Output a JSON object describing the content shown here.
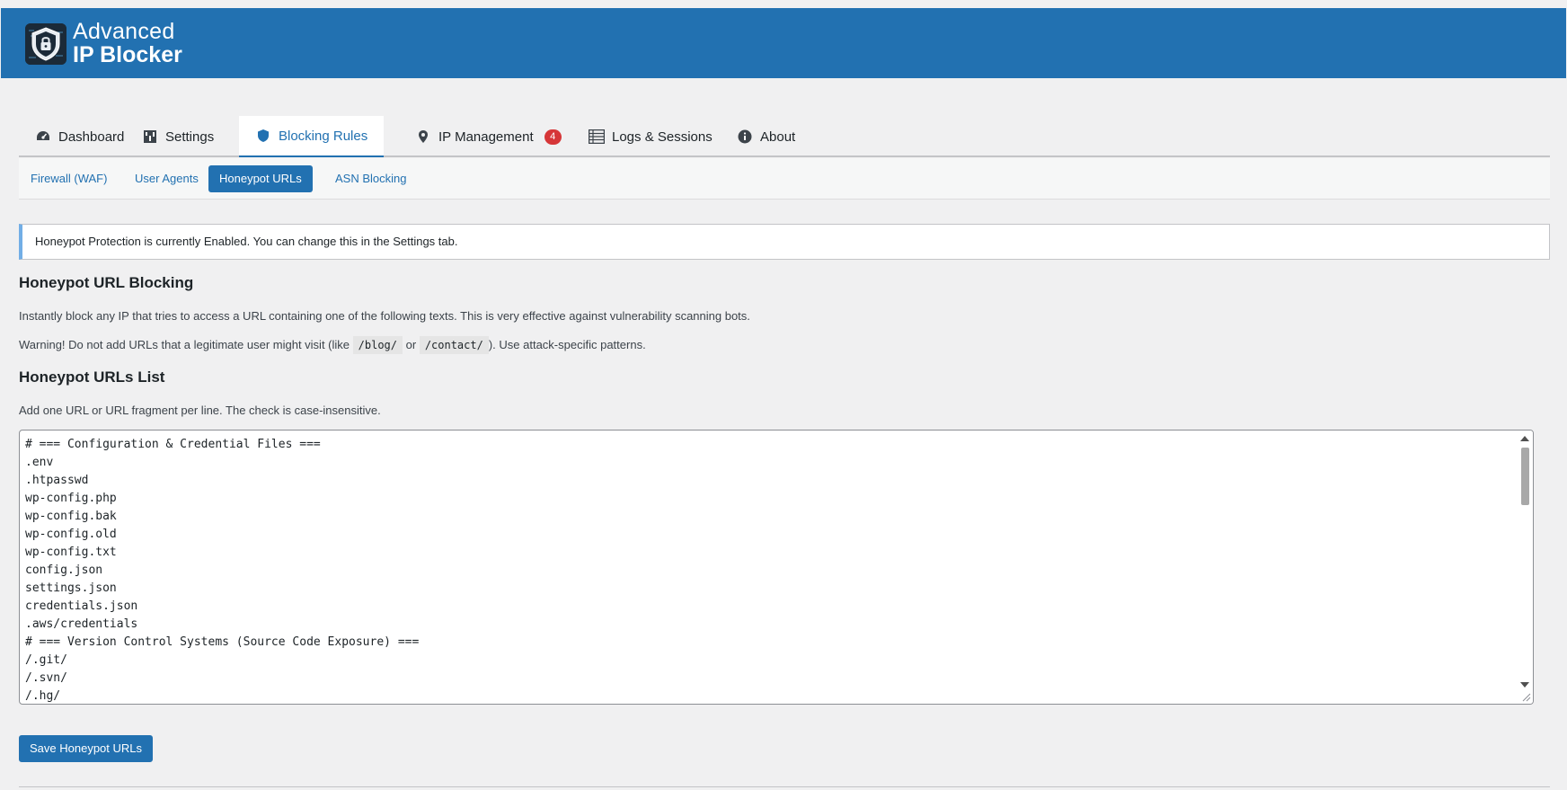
{
  "header": {
    "logo_line1": "Advanced",
    "logo_line2": "IP Blocker",
    "background": "#2271b1"
  },
  "tabs": [
    {
      "label": "Dashboard",
      "icon": "dashboard-icon",
      "active": false
    },
    {
      "label": "Settings",
      "icon": "settings-icon",
      "active": false
    },
    {
      "label": "Blocking Rules",
      "icon": "shield-icon",
      "active": true
    },
    {
      "label": "IP Management",
      "icon": "location-pin-icon",
      "active": false,
      "badge": "4"
    },
    {
      "label": "Logs & Sessions",
      "icon": "list-icon",
      "active": false
    },
    {
      "label": "About",
      "icon": "info-icon",
      "active": false
    }
  ],
  "subtabs": [
    {
      "label": "Firewall (WAF)",
      "active": false
    },
    {
      "label": "User Agents",
      "active": false
    },
    {
      "label": "Honeypot URLs",
      "active": true
    },
    {
      "label": "ASN Blocking",
      "active": false
    }
  ],
  "notice": "Honeypot Protection is currently Enabled. You can change this in the Settings tab.",
  "section1": {
    "title": "Honeypot URL Blocking",
    "description": "Instantly block any IP that tries to access a URL containing one of the following texts. This is very effective against vulnerability scanning bots.",
    "warning_prefix": "Warning! Do not add URLs that a legitimate user might visit (like",
    "example1": "/blog/",
    "warning_or": "or",
    "example2": "/contact/",
    "warning_suffix": "). Use attack-specific patterns."
  },
  "section2": {
    "title": "Honeypot URLs List",
    "description": "Add one URL or URL fragment per line. The check is case-insensitive."
  },
  "textarea_lines": [
    "# === Configuration & Credential Files ===",
    ".env",
    ".htpasswd",
    "wp-config.php",
    "wp-config.bak",
    "wp-config.old",
    "wp-config.txt",
    "config.json",
    "settings.json",
    "credentials.json",
    ".aws/credentials",
    "# === Version Control Systems (Source Code Exposure) ===",
    "/.git/",
    "/.svn/",
    "/.hg/"
  ],
  "save_button": "Save Honeypot URLs",
  "colors": {
    "accent": "#2271b1",
    "badge": "#d63638",
    "notice_border": "#72aee6"
  }
}
